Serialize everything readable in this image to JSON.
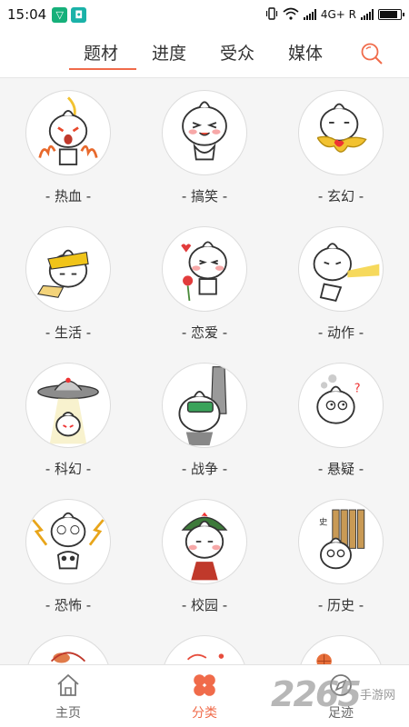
{
  "status_bar": {
    "time": "15:04",
    "network": "4G+ R",
    "battery_level": 0.85
  },
  "tabs": [
    {
      "label": "题材",
      "active": true
    },
    {
      "label": "进度",
      "active": false
    },
    {
      "label": "受众",
      "active": false
    },
    {
      "label": "媒体",
      "active": false
    }
  ],
  "icons": {
    "search": "search-icon",
    "home": "home-icon",
    "category": "four-petal-icon",
    "footprint": "compass-icon"
  },
  "colors": {
    "accent": "#f06b4a",
    "text": "#333333",
    "background": "#f5f5f5"
  },
  "genres": [
    {
      "label": "- 热血 -",
      "art": "fire"
    },
    {
      "label": "- 搞笑 -",
      "art": "laugh"
    },
    {
      "label": "- 玄幻 -",
      "art": "fantasy"
    },
    {
      "label": "- 生活 -",
      "art": "life"
    },
    {
      "label": "- 恋爱 -",
      "art": "love"
    },
    {
      "label": "- 动作 -",
      "art": "action"
    },
    {
      "label": "- 科幻 -",
      "art": "ufo"
    },
    {
      "label": "- 战争 -",
      "art": "war"
    },
    {
      "label": "- 悬疑 -",
      "art": "mystery"
    },
    {
      "label": "- 恐怖 -",
      "art": "horror"
    },
    {
      "label": "- 校园 -",
      "art": "campus"
    },
    {
      "label": "- 历史 -",
      "art": "history"
    }
  ],
  "bottom_nav": [
    {
      "label": "主页",
      "active": false
    },
    {
      "label": "分类",
      "active": true
    },
    {
      "label": "足迹",
      "active": false
    }
  ],
  "watermark": {
    "number": "2265",
    "text": "手游网"
  }
}
